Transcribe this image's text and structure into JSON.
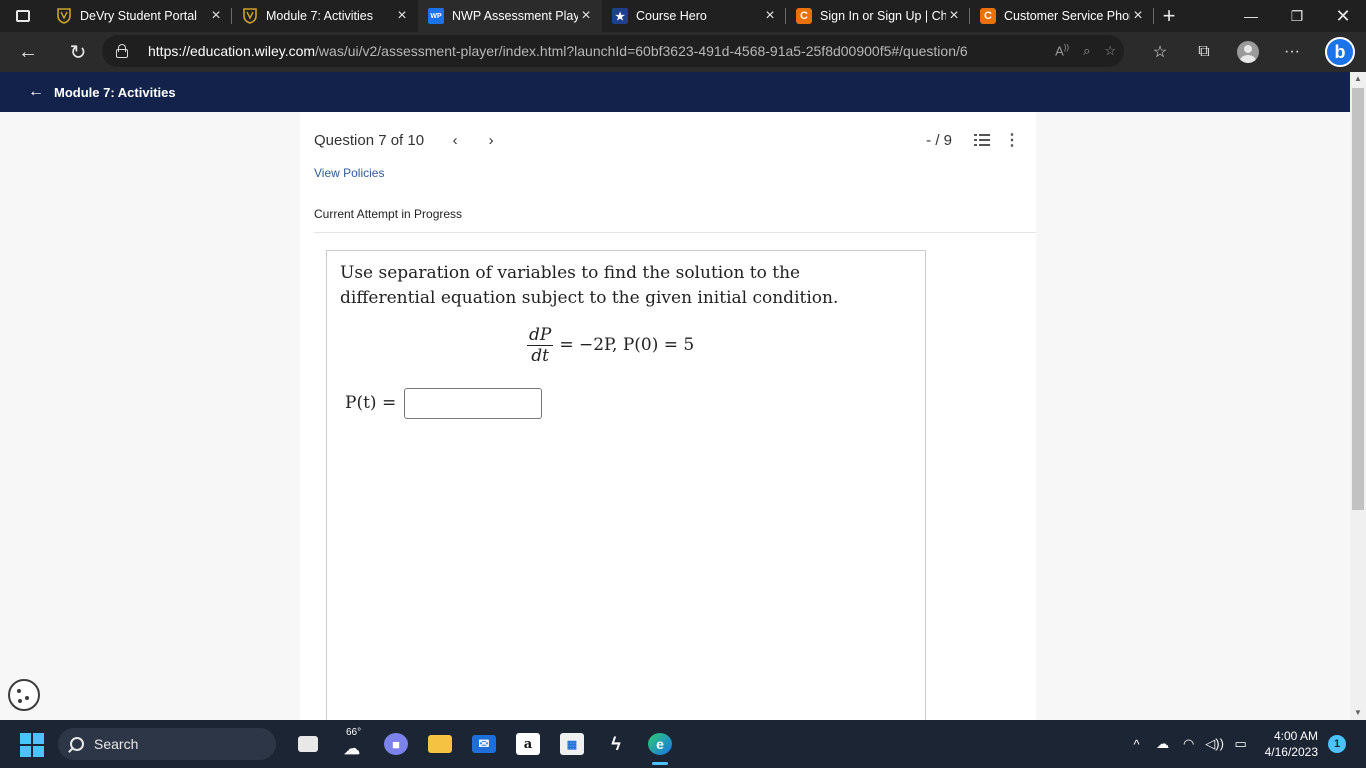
{
  "browser": {
    "tabs": [
      {
        "title": "DeVry Student Portal",
        "favicon": "devry-shield-icon",
        "active": false
      },
      {
        "title": "Module 7: Activities",
        "favicon": "devry-shield-icon",
        "active": false
      },
      {
        "title": "NWP Assessment Play",
        "favicon": "wp-icon",
        "active": true
      },
      {
        "title": "Course Hero",
        "favicon": "star-icon",
        "active": false
      },
      {
        "title": "Sign In or Sign Up | Ch",
        "favicon": "chegg-c-icon",
        "active": false
      },
      {
        "title": "Customer Service Phor",
        "favicon": "chegg-c-icon",
        "active": false
      }
    ],
    "favicon_labels": {
      "wp": "WP",
      "chegg": "C",
      "star": "★"
    },
    "url_host": "https://education.wiley.com",
    "url_rest": "/was/ui/v2/assessment-player/index.html?launchId=60bf3623-491d-4568-91a5-25f8d00900f5#/question/6",
    "bing_label": "b"
  },
  "app": {
    "back_label": "Module 7: Activities"
  },
  "question": {
    "counter": "Question 7 of 10",
    "score": "- / 9",
    "view_policies": "View Policies",
    "attempt_status": "Current Attempt in Progress",
    "prompt": "Use separation of variables to find the solution to the differential equation subject to the given initial condition.",
    "equation": {
      "numerator": "dP",
      "denominator": "dt",
      "rhs": "= −2P, P(0) = 5"
    },
    "answer_label": "P(t) =",
    "answer_value": ""
  },
  "taskbar": {
    "search_label": "Search",
    "weather_temp": "66°",
    "time": "4:00 AM",
    "date": "4/16/2023",
    "notification_count": "1",
    "amazon_label": "a"
  },
  "colors": {
    "app_header": "#13224a",
    "link": "#2e5c9a",
    "taskbar": "#1c2534",
    "accent": "#4cc2ff"
  }
}
